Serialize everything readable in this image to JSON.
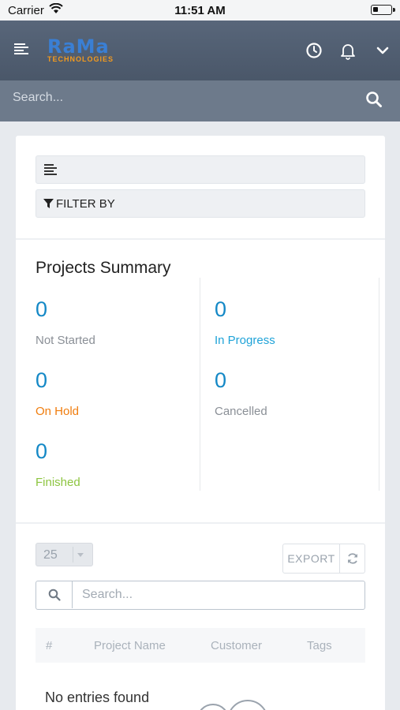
{
  "status_bar": {
    "carrier": "Carrier",
    "time": "11:51 AM"
  },
  "header": {
    "logo_text": "RaMa",
    "logo_subtitle": "TECHNOLOGIES",
    "icons": [
      "menu-icon",
      "clock-icon",
      "bell-icon",
      "chevron-down-icon"
    ]
  },
  "search": {
    "placeholder": "Search..."
  },
  "filters": {
    "filter_by_label": "FILTER BY"
  },
  "summary": {
    "title": "Projects Summary",
    "stats": [
      {
        "label": "Not Started",
        "value": "0",
        "color": "#8a8f96"
      },
      {
        "label": "In Progress",
        "value": "0",
        "color": "#1fa3d8"
      },
      {
        "label": "On Hold",
        "value": "0",
        "color": "#f07d0e"
      },
      {
        "label": "Cancelled",
        "value": "0",
        "color": "#8a8f96"
      },
      {
        "label": "Finished",
        "value": "0",
        "color": "#8dc540"
      }
    ]
  },
  "table": {
    "page_size": "25",
    "export_label": "EXPORT",
    "search_placeholder": "Search...",
    "columns": [
      "#",
      "Project Name",
      "Customer",
      "Tags"
    ],
    "empty_text": "No entries found"
  },
  "colors": {
    "accent": "#1488c6",
    "nav_bg": "#4f5c6f",
    "search_bg": "#6d7a8b"
  }
}
